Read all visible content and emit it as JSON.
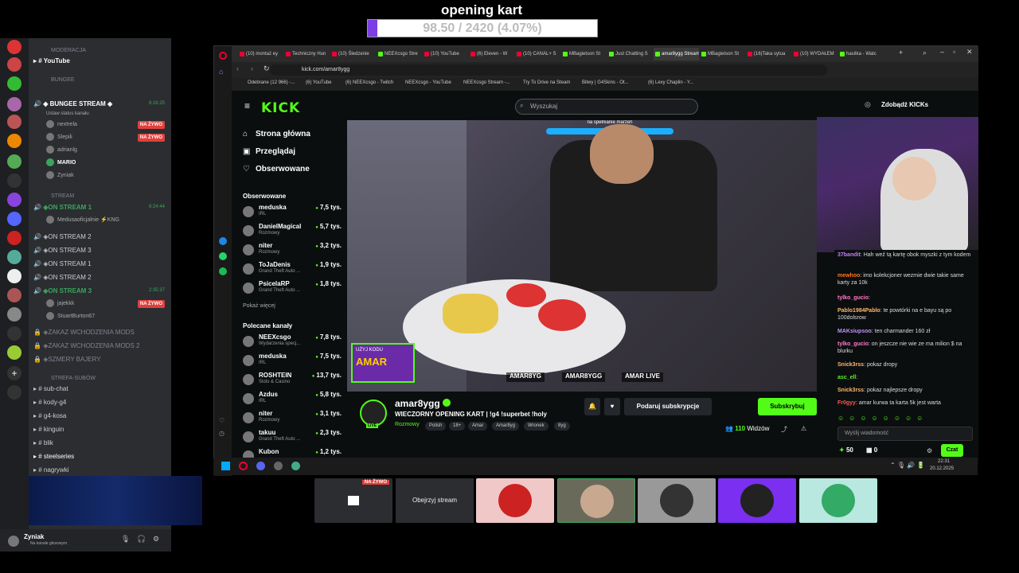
{
  "overlay": {
    "title": "opening kart",
    "progress_text": "98.50 / 2420 (4.07%)",
    "progress_fraction": 0.0407,
    "accent": "#7b3fe4"
  },
  "discord": {
    "categories": [
      "MODERACJA",
      "BUNGEE",
      "STREAM",
      "STREFA-SUBÓW"
    ],
    "youtube": "YouTube",
    "bungee_stream": "◈ BUNGEE STREAM ◈",
    "bungee_time": "6:16:25",
    "bungee_status": "Ustaw status kanału",
    "users_bungee": [
      "nextrela",
      "Slepili",
      "adrianlg",
      "MARIO",
      "Zyniak"
    ],
    "on_stream_1": "◈ON STREAM 1",
    "on_stream_1_time": "6:24:44",
    "mudusa_user": "Medusaoficjalnie ⚡KNG",
    "on_stream_items": [
      "◈ON STREAM 2",
      "◈ON STREAM 3",
      "◈ON STREAM 1",
      "◈ON STREAM 2"
    ],
    "on_stream_3": "◈ON STREAM 3",
    "on_stream_3_time": "2:35:37",
    "users_s3": [
      "jajekkk",
      "StuartBurton67"
    ],
    "live_badge": "NA ŻYWO",
    "locked": [
      "◈ZAKAZ WCHODZENIA MODS",
      "◈ZAKAZ WCHODZENIA MODS 2",
      "◈SZMERY BAJERY"
    ],
    "text_channels": [
      "sub-chat",
      "kody-g4",
      "g4-kosa",
      "kinguin",
      "blik",
      "steelseries",
      "nagrywki"
    ],
    "user": {
      "name": "Zyniak",
      "status": "Na kanale głosowym"
    }
  },
  "browser": {
    "tabs": [
      "(10) montaż ey",
      "Techniczny Hun",
      "(10) Śledzenie",
      "NEEXcsgo Stre",
      "(10) YouTube",
      "(6) Eleven - W",
      "(10) CANAL+ S",
      "MBagietson St",
      "Just Chatting S",
      "amar8ygg Stream",
      "MBagietson St",
      "(16)Taka sytua",
      "(10) WYDAŁEM",
      "hasitka - Watc"
    ],
    "url": "kick.com/amar8ygg",
    "bookmarks": [
      "Odebrane (12 966) -...",
      "(6) YouTube",
      "(6) NEEXcsgo - Twitch",
      "NEEXcsgo - YouTube",
      "NEEXcsgo Stream -...",
      "Try To Drive na Steam",
      "Bitwy | G4Skins - Ot...",
      "(6) Lexy Chaplin - Y..."
    ],
    "clock_time": "22:31",
    "clock_date": "20.12.2025"
  },
  "kick": {
    "logo": "KICK",
    "search_placeholder": "Wyszukaj",
    "get_kicks": "Zdobądź KICKs",
    "nav": [
      "Strona główna",
      "Przeglądaj",
      "Obserwowane"
    ],
    "followed_title": "Obserwowane",
    "followed": [
      {
        "name": "meduska",
        "sub": "IRL",
        "viewers": "7,5 tys."
      },
      {
        "name": "DanielMagical",
        "sub": "Rozmowy",
        "viewers": "5,7 tys."
      },
      {
        "name": "niter",
        "sub": "Rozmowy",
        "viewers": "3,2 tys."
      },
      {
        "name": "ToJaDenis",
        "sub": "Grand Theft Auto ...",
        "viewers": "1,9 tys."
      },
      {
        "name": "PsicelaRP",
        "sub": "Grand Theft Auto ...",
        "viewers": "1,8 tys."
      }
    ],
    "show_more": "Pokaż więcej",
    "recommended_title": "Polecane kanały",
    "recommended": [
      {
        "name": "NEEXcsgo",
        "sub": "Wydarzenia specj...",
        "viewers": "7,8 tys."
      },
      {
        "name": "meduska",
        "sub": "IRL",
        "viewers": "7,5 tys."
      },
      {
        "name": "ROSHTEIN",
        "sub": "Slots & Casino",
        "viewers": "13,7 tys."
      },
      {
        "name": "Azdus",
        "sub": "IRL",
        "viewers": "5,8 tys."
      },
      {
        "name": "niter",
        "sub": "Rozmowy",
        "viewers": "3,1 tys."
      },
      {
        "name": "takuu",
        "sub": "Grand Theft Auto ...",
        "viewers": "2,3 tys."
      },
      {
        "name": "Kubon",
        "sub": "",
        "viewers": "1,2 tys."
      }
    ],
    "video_banner": "na spełnianie marzeń",
    "video_overlay_tags": [
      "AMAR8YG",
      "AMAR8YGG",
      "AMAR LIVE"
    ],
    "video_code_label": "UŻYJ KODU",
    "video_code": "AMAR",
    "stream": {
      "name": "amar8ygg",
      "title": "WIECZORNY OPENING KART | !g4 !superbet !holy",
      "category": "Rozmowy",
      "tags": [
        "Polish",
        "18+",
        "Amar",
        "Amar8yg",
        "Wronek",
        "8yg"
      ],
      "gift_label": "Podaruj subskrypcje",
      "subscribe_label": "Subskrybuj",
      "viewers": "110",
      "viewers_label": "Widzów",
      "live": "LIVE"
    },
    "chat": [
      {
        "user": "37bandit",
        "color": "#c77dff",
        "text": "Hah weź tą kartę obok myszki z tym kodem"
      },
      {
        "user": "mewhoo",
        "color": "#ff7a18",
        "text": "imo kolekcjoner wezmie dwie takie same karty za 10k"
      },
      {
        "user": "tylko_gucio",
        "color": "#ff79c6",
        "text": ""
      },
      {
        "user": "Pablo1984Pablo",
        "color": "#ffb86c",
        "text": "te powtórki na e bayu są po 100dolsrow"
      },
      {
        "user": "MAKsiupsoo",
        "color": "#bd93f9",
        "text": "ten charmander 160 zł"
      },
      {
        "user": "tylko_gucio",
        "color": "#ff79c6",
        "text": "on jeszcze nie wie ze ma milion $ na blurku"
      },
      {
        "user": "Snick3rss",
        "color": "#ffb86c",
        "text": "pokaz dropy"
      },
      {
        "user": "asc_ell",
        "color": "#53fc18",
        "text": ""
      },
      {
        "user": "Snick3rss",
        "color": "#ffb86c",
        "text": "pokaz najlepsze dropy"
      },
      {
        "user": "Fr0gyy",
        "color": "#ff5555",
        "text": "amar kurwa ta karta 5k jest warta"
      }
    ],
    "chat_placeholder": "Wyślij wiadomość",
    "chat_points": "50",
    "chat_count": "0",
    "chat_button": "Czat"
  },
  "bottom": {
    "watch_label": "Obejrzyj stream",
    "live_badge": "NA ŻYWO"
  }
}
